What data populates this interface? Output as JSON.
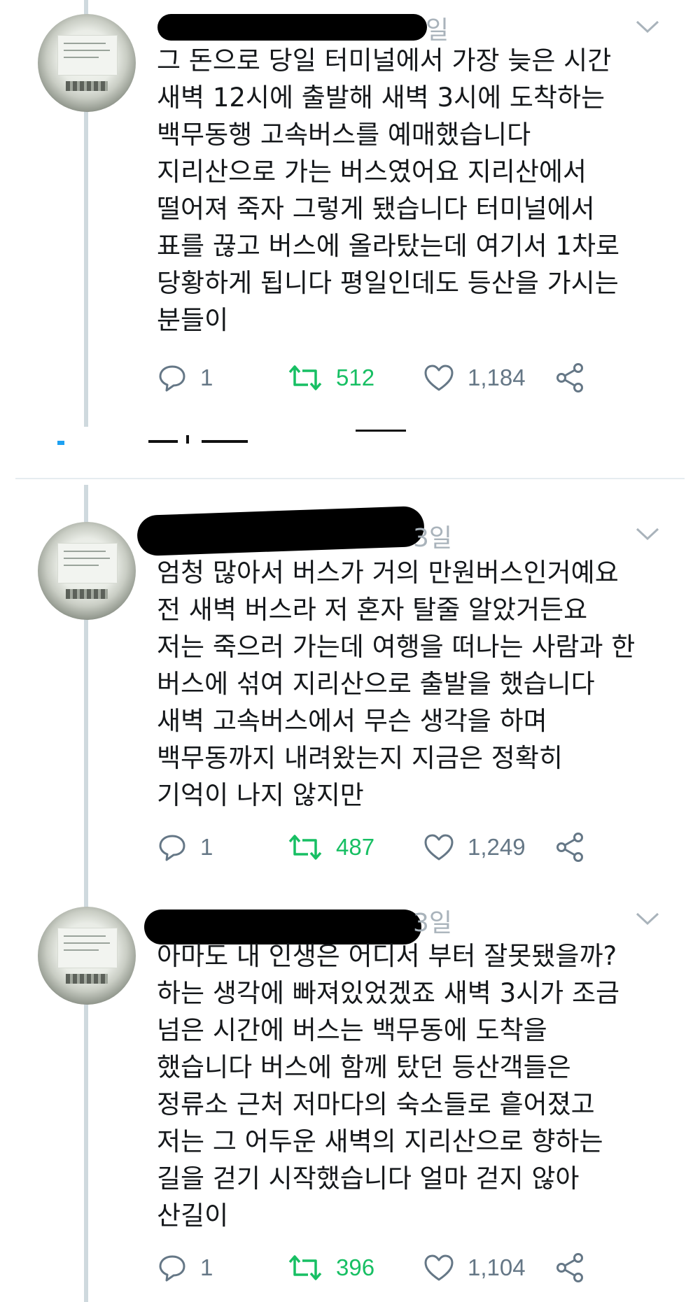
{
  "tweets": [
    {
      "date_suffix": "일",
      "lines": [
        "그 돈으로 당일 터미널에서 가장 늦은 시간",
        "새벽 12시에 출발해 새벽 3시에 도착하는",
        "백무동행 고속버스를 예매했습니다",
        "지리산으로 가는 버스였어요 지리산에서",
        "떨어져 죽자 그렇게 됐습니다 터미널에서",
        "표를 끊고 버스에 올라탔는데 여기서 1차로",
        "당황하게 됩니다 평일인데도 등산을 가시는",
        "분들이"
      ],
      "replies": "1",
      "retweets": "512",
      "likes": "1,184"
    },
    {
      "date_suffix": "3일",
      "lines": [
        "엄청 많아서 버스가 거의 만원버스인거예요",
        "전 새벽 버스라 저 혼자 탈줄 알았거든요",
        "저는 죽으러 가는데 여행을 떠나는 사람과 한",
        "버스에 섞여 지리산으로 출발을 했습니다",
        "새벽 고속버스에서 무슨 생각을 하며",
        "백무동까지 내려왔는지 지금은 정확히",
        "기억이 나지 않지만"
      ],
      "replies": "1",
      "retweets": "487",
      "likes": "1,249"
    },
    {
      "date_suffix": "3일",
      "lines": [
        "아마도 내 인생은 어디서 부터 잘못됐을까?",
        "하는 생각에 빠져있었겠죠 새벽 3시가 조금",
        "넘은 시간에 버스는 백무동에 도착을",
        "했습니다 버스에 함께 탔던 등산객들은",
        "정류소 근처 저마다의 숙소들로 흩어졌고",
        "저는 그 어두운 새벽의 지리산으로 향하는",
        "길을 걷기 시작했습니다 얼마 걷지 않아",
        "산길이"
      ],
      "replies": "1",
      "retweets": "396",
      "likes": "1,104"
    }
  ],
  "colors": {
    "thread_line": "#cfd9de",
    "retweet_green": "#17bf63",
    "icon_gray": "#657786",
    "date_gray": "#a9b3bb"
  },
  "icons": [
    "reply-icon",
    "retweet-icon",
    "like-icon",
    "share-icon",
    "chevron-down-icon"
  ]
}
